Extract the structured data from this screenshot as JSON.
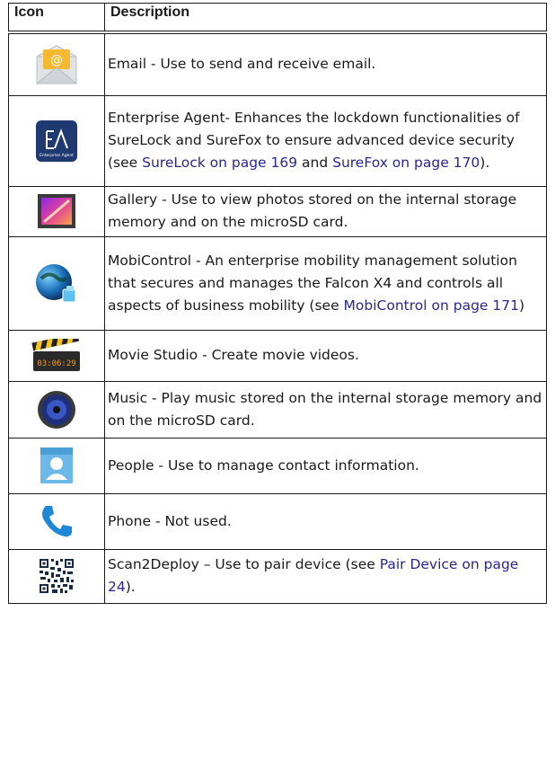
{
  "header": {
    "icon": "Icon",
    "description": "Description"
  },
  "rows": [
    {
      "icon": "email-icon",
      "parts": [
        {
          "t": "Email - Use to send and receive email."
        }
      ]
    },
    {
      "icon": "enterprise-agent-icon",
      "icon_label": "Enterprise Agent",
      "parts": [
        {
          "t": "Enterprise Agent- Enhances the lockdown functionalities of SureLock and SureFox to ensure advanced device security (see "
        },
        {
          "t": "SureLock on page 169",
          "link": true
        },
        {
          "t": " and "
        },
        {
          "t": "SureFox on page 170",
          "link": true
        },
        {
          "t": ")."
        }
      ]
    },
    {
      "icon": "gallery-icon",
      "parts": [
        {
          "t": "Gallery - Use to view photos stored on the internal storage memory and on the microSD card."
        }
      ]
    },
    {
      "icon": "mobicontrol-icon",
      "parts": [
        {
          "t": "MobiControl - An enterprise mobility management solution that secures and manages the Falcon X4 and controls all aspects of business mobility (see "
        },
        {
          "t": "MobiControl on page 171",
          "link": true
        },
        {
          "t": ")"
        }
      ]
    },
    {
      "icon": "movie-studio-icon",
      "icon_label": "03:06:29",
      "parts": [
        {
          "t": "Movie Studio - Create movie videos."
        }
      ]
    },
    {
      "icon": "music-icon",
      "parts": [
        {
          "t": "Music - Play music stored on the internal storage memory and on the microSD card."
        }
      ]
    },
    {
      "icon": "people-icon",
      "parts": [
        {
          "t": "People - Use to manage contact information."
        }
      ]
    },
    {
      "icon": "phone-icon",
      "parts": [
        {
          "t": "Phone - Not used."
        }
      ]
    },
    {
      "icon": "scan2deploy-icon",
      "parts": [
        {
          "t": "Scan2Deploy – Use to pair device (see "
        },
        {
          "t": "Pair Device on page 24",
          "link": true
        },
        {
          "t": ")."
        }
      ]
    }
  ],
  "colors": {
    "link": "#27278f",
    "border": "#1a1a1a"
  }
}
